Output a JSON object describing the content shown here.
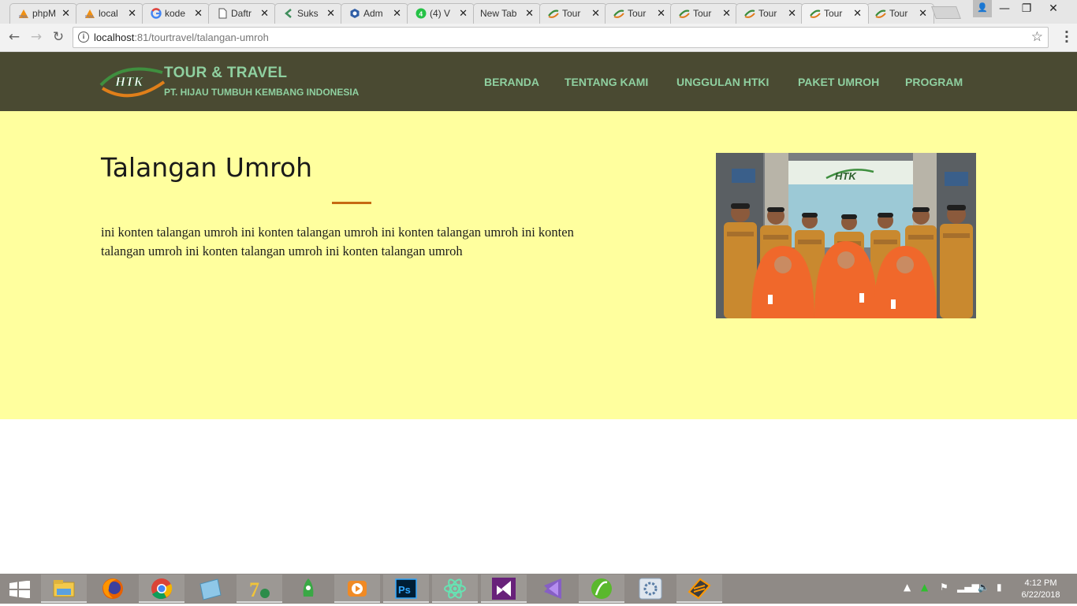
{
  "browser": {
    "tabs": [
      {
        "title": "phpM",
        "icon": "phpmyadmin-icon"
      },
      {
        "title": "local",
        "icon": "phpmyadmin-icon"
      },
      {
        "title": "kode",
        "icon": "google-icon"
      },
      {
        "title": "Daftr",
        "icon": "document-icon"
      },
      {
        "title": "Suks",
        "icon": "arrow-icon"
      },
      {
        "title": "Adm",
        "icon": "hexagon-icon"
      },
      {
        "title": "(4) V",
        "icon": "whatsapp-icon"
      },
      {
        "title": "New Tab",
        "icon": ""
      },
      {
        "title": "Tour",
        "icon": "htk-icon"
      },
      {
        "title": "Tour",
        "icon": "htk-icon"
      },
      {
        "title": "Tour",
        "icon": "htk-icon"
      },
      {
        "title": "Tour",
        "icon": "htk-icon"
      },
      {
        "title": "Tour",
        "icon": "htk-icon"
      },
      {
        "title": "Tour",
        "icon": "htk-icon"
      }
    ],
    "active_tab": 12,
    "url_host": "localhost",
    "url_rest": ":81/tourtravel/talangan-umroh"
  },
  "site": {
    "brand_title": "TOUR & TRAVEL",
    "brand_subtitle": "PT. HIJAU TUMBUH KEMBANG INDONESIA",
    "logo_text": "HTK",
    "nav": [
      "BERANDA",
      "TENTANG KAMI",
      "UNGGULAN HTKI",
      "PAKET UMROH",
      "PROGRAM"
    ],
    "colors": {
      "header_bg": "#4a4a32",
      "nav_text": "#8fd0a0",
      "content_bg": "#ffff9e",
      "accent": "#c66a12"
    }
  },
  "page": {
    "title": "Talangan Umroh",
    "body": "ini konten talangan umroh ini konten talangan umroh ini konten talangan umroh ini konten talangan umroh ini konten talangan umroh ini konten talangan umroh",
    "photo_sign": "HTK"
  },
  "taskbar": {
    "apps": [
      "file-explorer-icon",
      "firefox-icon",
      "chrome-icon",
      "notepad-icon",
      "7zip-icon",
      "launcher-icon",
      "media-player-icon",
      "photoshop-icon",
      "atom-icon",
      "visual-studio-icon",
      "visual-studio-code-icon",
      "dreamweaver-icon",
      "settings-icon",
      "sublime-icon"
    ],
    "time": "4:12 PM",
    "date": "6/22/2018"
  }
}
